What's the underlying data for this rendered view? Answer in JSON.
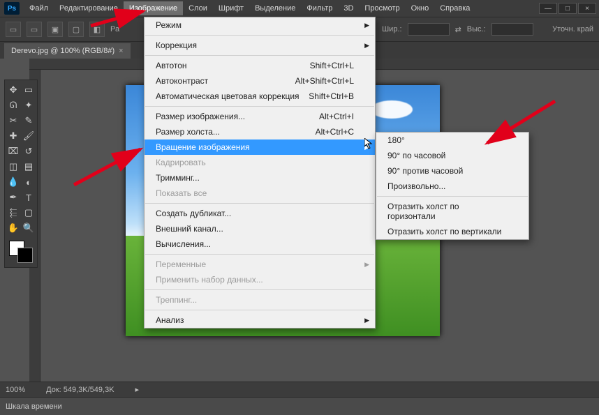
{
  "menu": [
    "Файл",
    "Редактирование",
    "Изображение",
    "Слои",
    "Шрифт",
    "Выделение",
    "Фильтр",
    "3D",
    "Просмотр",
    "Окно",
    "Справка"
  ],
  "menu_active_index": 2,
  "options": {
    "ra_label": "Ра",
    "shir_label": "Шир.:",
    "vys_label": "Выс.:",
    "crop_btn": "Уточн. край"
  },
  "tab": {
    "title": "Derevo.jpg @ 100% (RGB/8#)"
  },
  "image_menu": {
    "items": [
      {
        "label": "Режим",
        "arrow": true
      },
      {
        "sep": true
      },
      {
        "label": "Коррекция",
        "arrow": true
      },
      {
        "sep": true
      },
      {
        "label": "Автотон",
        "shortcut": "Shift+Ctrl+L"
      },
      {
        "label": "Автоконтраст",
        "shortcut": "Alt+Shift+Ctrl+L"
      },
      {
        "label": "Автоматическая цветовая коррекция",
        "shortcut": "Shift+Ctrl+B"
      },
      {
        "sep": true
      },
      {
        "label": "Размер изображения...",
        "shortcut": "Alt+Ctrl+I"
      },
      {
        "label": "Размер холста...",
        "shortcut": "Alt+Ctrl+C"
      },
      {
        "label": "Вращение изображения",
        "arrow": true,
        "highlight": true
      },
      {
        "label": "Кадрировать",
        "disabled": true
      },
      {
        "label": "Тримминг..."
      },
      {
        "label": "Показать все",
        "disabled": true
      },
      {
        "sep": true
      },
      {
        "label": "Создать дубликат..."
      },
      {
        "label": "Внешний канал..."
      },
      {
        "label": "Вычисления..."
      },
      {
        "sep": true
      },
      {
        "label": "Переменные",
        "arrow": true,
        "disabled": true
      },
      {
        "label": "Применить набор данных...",
        "disabled": true
      },
      {
        "sep": true
      },
      {
        "label": "Треппинг...",
        "disabled": true
      },
      {
        "sep": true
      },
      {
        "label": "Анализ",
        "arrow": true
      }
    ]
  },
  "rotate_submenu": {
    "items": [
      {
        "label": "180°"
      },
      {
        "label": "90° по часовой"
      },
      {
        "label": "90° против часовой"
      },
      {
        "label": "Произвольно..."
      },
      {
        "sep": true
      },
      {
        "label": "Отразить холст по горизонтали"
      },
      {
        "label": "Отразить холст по вертикали"
      }
    ]
  },
  "status": {
    "zoom": "100%",
    "doc": "Док: 549,3K/549,3K"
  },
  "timeline": {
    "label": "Шкала времени"
  },
  "tools": [
    "move",
    "marquee",
    "lasso",
    "wand",
    "crop",
    "eyedropper",
    "heal",
    "brush",
    "stamp",
    "history",
    "eraser",
    "gradient",
    "blur",
    "dodge",
    "pen",
    "type",
    "path",
    "shape",
    "hand",
    "zoom"
  ]
}
